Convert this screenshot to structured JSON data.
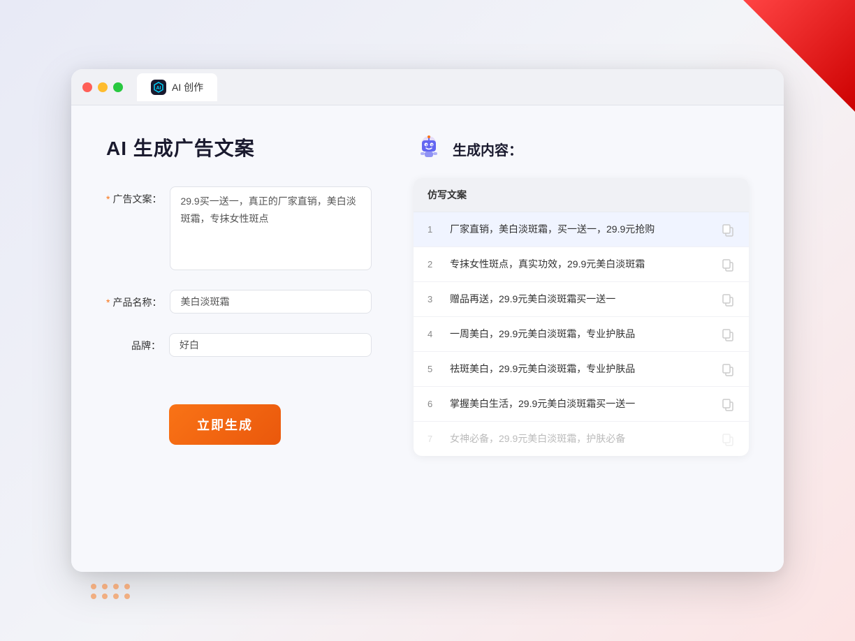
{
  "window": {
    "tab_icon": "AI",
    "tab_title": "AI 创作"
  },
  "left_panel": {
    "title": "AI 生成广告文案",
    "fields": [
      {
        "label": "广告文案：",
        "required": true,
        "type": "textarea",
        "value": "29.9买一送一，真正的厂家直销，美白淡斑霜，专抹女性斑点",
        "name": "ad-copy-input"
      },
      {
        "label": "产品名称：",
        "required": true,
        "type": "text",
        "value": "美白淡斑霜",
        "name": "product-name-input"
      },
      {
        "label": "品牌：",
        "required": false,
        "type": "text",
        "value": "好白",
        "name": "brand-input"
      }
    ],
    "submit_button": "立即生成"
  },
  "right_panel": {
    "title": "生成内容：",
    "column_header": "仿写文案",
    "results": [
      {
        "num": "1",
        "text": "厂家直销，美白淡斑霜，买一送一，29.9元抢购",
        "faded": false
      },
      {
        "num": "2",
        "text": "专抹女性斑点，真实功效，29.9元美白淡斑霜",
        "faded": false
      },
      {
        "num": "3",
        "text": "赠品再送，29.9元美白淡斑霜买一送一",
        "faded": false
      },
      {
        "num": "4",
        "text": "一周美白，29.9元美白淡斑霜，专业护肤品",
        "faded": false
      },
      {
        "num": "5",
        "text": "祛斑美白，29.9元美白淡斑霜，专业护肤品",
        "faded": false
      },
      {
        "num": "6",
        "text": "掌握美白生活，29.9元美白淡斑霜买一送一",
        "faded": false
      },
      {
        "num": "7",
        "text": "女神必备，29.9元美白淡斑霜，护肤必备",
        "faded": true
      }
    ]
  },
  "colors": {
    "orange": "#f97316",
    "accent": "#6366f1"
  }
}
